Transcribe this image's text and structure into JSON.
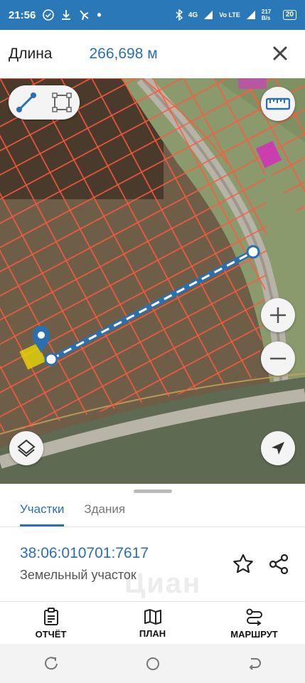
{
  "status_bar": {
    "time": "21:56",
    "network": "4G",
    "volte": "Vo LTE",
    "speed": "217 B/s",
    "battery": "20",
    "icons": [
      "check-circle-icon",
      "download-icon",
      "pinwheel-icon",
      "dot-icon",
      "bluetooth-icon",
      "signal-icon",
      "signal-icon"
    ]
  },
  "header": {
    "label": "Длина",
    "value": "266,698 м"
  },
  "map": {
    "tools": [
      "line-measure-icon",
      "area-measure-icon"
    ],
    "accent": "#2a6fb0",
    "parcel_line_color": "#ff5a3c",
    "selected_parcel_color": "#f0e000"
  },
  "tabs": [
    {
      "label": "Участки",
      "active": true
    },
    {
      "label": "Здания",
      "active": false
    }
  ],
  "parcel": {
    "id": "38:06:010701:7617",
    "type": "Земельный участок",
    "watermark": "Циан"
  },
  "bottom_nav": [
    {
      "label": "ОТЧЁТ",
      "icon": "report-icon"
    },
    {
      "label": "ПЛАН",
      "icon": "map-plan-icon"
    },
    {
      "label": "МАРШРУТ",
      "icon": "route-icon"
    }
  ]
}
